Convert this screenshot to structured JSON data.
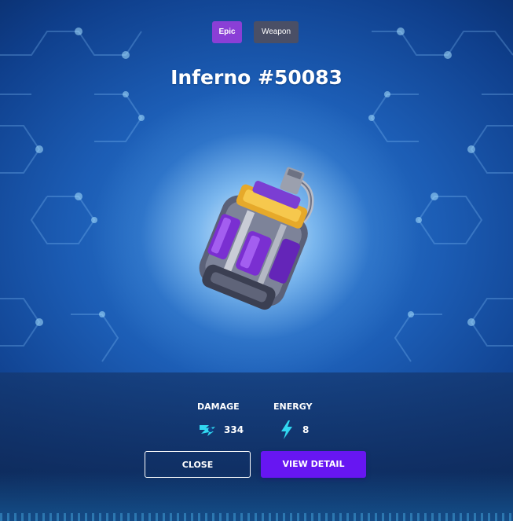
{
  "badges": {
    "rarity": "Epic",
    "type": "Weapon"
  },
  "item": {
    "title": "Inferno #50083",
    "image": "purple-grenade"
  },
  "stats": {
    "damage": {
      "label": "DAMAGE",
      "value": "334",
      "icon": "damage-blast-icon"
    },
    "energy": {
      "label": "ENERGY",
      "value": "8",
      "icon": "lightning-bolt-icon"
    }
  },
  "buttons": {
    "close": "CLOSE",
    "view_detail": "VIEW DETAIL"
  },
  "colors": {
    "epic": "#8a3fd6",
    "weapon_badge": "#4a4f66",
    "primary_button": "#6716f2",
    "stat_icon": "#31d7f0"
  }
}
